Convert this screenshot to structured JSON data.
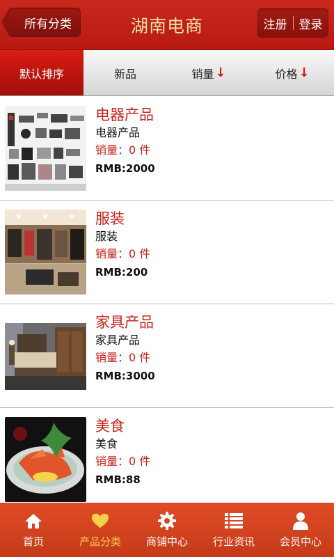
{
  "header": {
    "back_label": "所有分类",
    "title": "湖南电商",
    "register_label": "注册",
    "login_label": "登录"
  },
  "tabs": [
    {
      "label": "默认排序",
      "active": true,
      "arrow": ""
    },
    {
      "label": "新品",
      "active": false,
      "arrow": ""
    },
    {
      "label": "销量",
      "active": false,
      "arrow": "↓"
    },
    {
      "label": "价格",
      "active": false,
      "arrow": "↓"
    }
  ],
  "products": [
    {
      "name": "电器产品",
      "subtitle": "电器产品",
      "sales": "销量：0 件",
      "price": "RMB:2000",
      "image": "electronics"
    },
    {
      "name": "服装",
      "subtitle": "服装",
      "sales": "销量：0 件",
      "price": "RMB:200",
      "image": "clothing-store"
    },
    {
      "name": "家具产品",
      "subtitle": "家具产品",
      "sales": "销量：0 件",
      "price": "RMB:3000",
      "image": "bedroom"
    },
    {
      "name": "美食",
      "subtitle": "美食",
      "sales": "销量：0 件",
      "price": "RMB:88",
      "image": "seafood-dish"
    }
  ],
  "bottom_nav": [
    {
      "label": "首页",
      "icon": "home-icon",
      "active": false
    },
    {
      "label": "产品分类",
      "icon": "heart-icon",
      "active": true
    },
    {
      "label": "商铺中心",
      "icon": "gear-icon",
      "active": false
    },
    {
      "label": "行业资讯",
      "icon": "list-icon",
      "active": false
    },
    {
      "label": "会员中心",
      "icon": "user-icon",
      "active": false
    }
  ],
  "colors": {
    "brand_red": "#c8281d",
    "title_gold": "#f7e2a0",
    "nav_bg": "#d9441f",
    "nav_active": "#f8d048",
    "product_red": "#c8221a"
  }
}
